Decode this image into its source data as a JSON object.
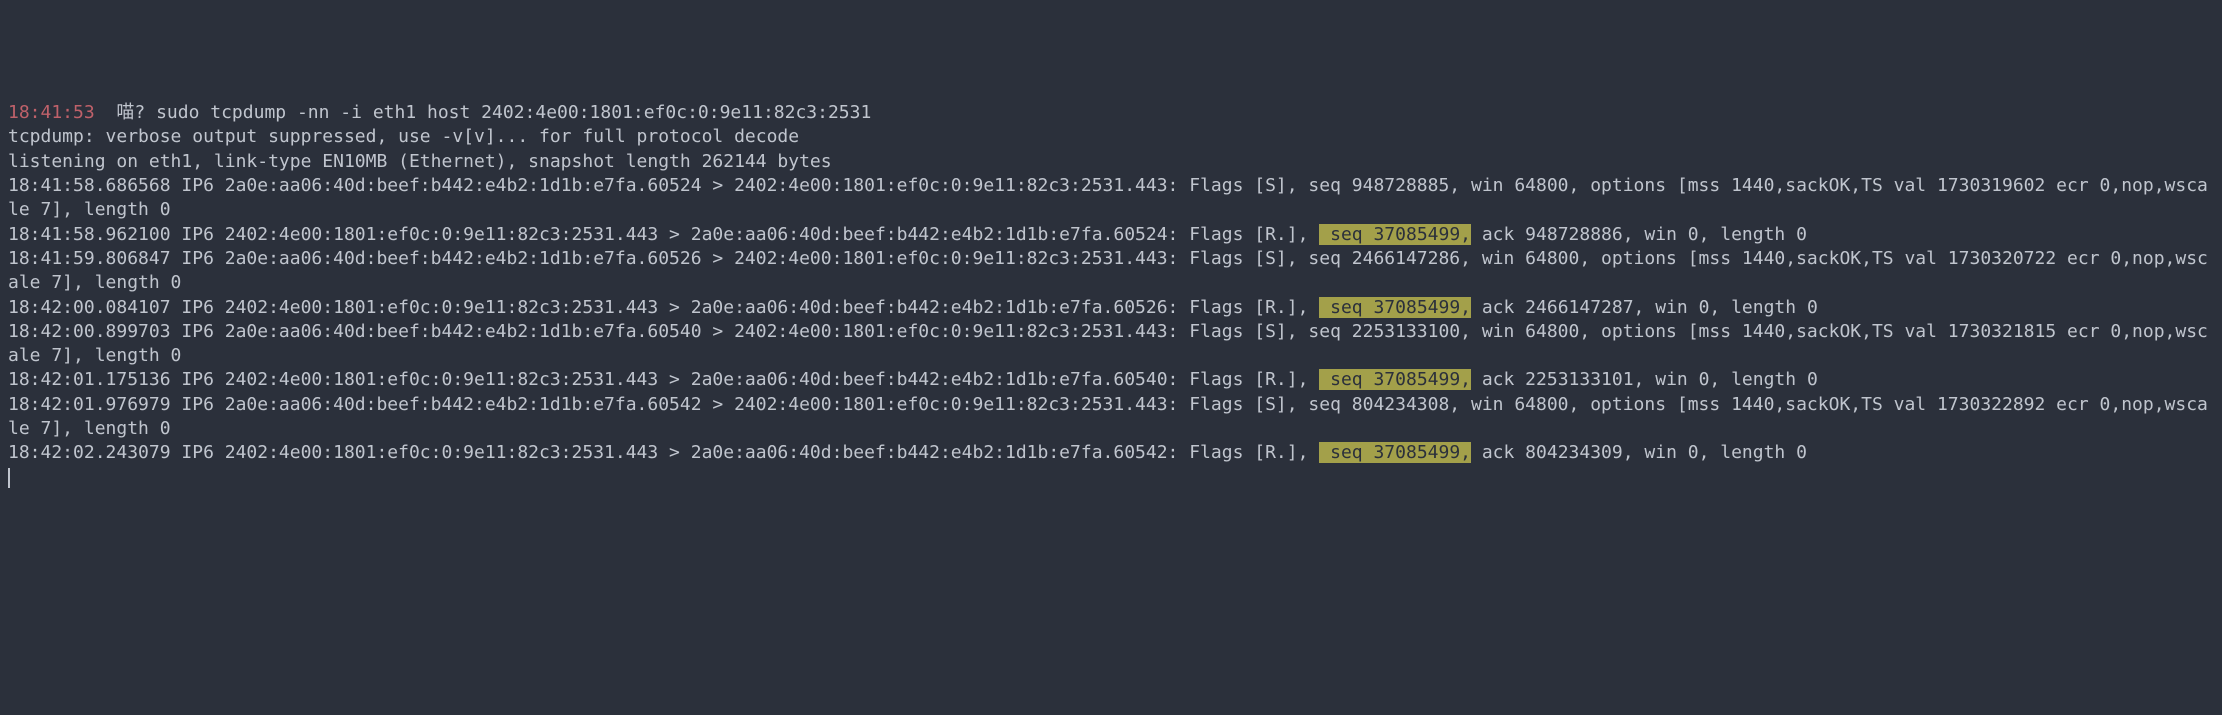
{
  "prompt": {
    "timestamp": "18:41:53",
    "marker": "喵?",
    "command": "sudo tcpdump -nn -i eth1 host 2402:4e00:1801:ef0c:0:9e11:82c3:2531"
  },
  "lines": [
    {
      "text": "tcpdump: verbose output suppressed, use -v[v]... for full protocol decode",
      "highlight": null
    },
    {
      "text": "listening on eth1, link-type EN10MB (Ethernet), snapshot length 262144 bytes",
      "highlight": null
    },
    {
      "text": "18:41:58.686568 IP6 2a0e:aa06:40d:beef:b442:e4b2:1d1b:e7fa.60524 > 2402:4e00:1801:ef0c:0:9e11:82c3:2531.443: Flags [S], seq 948728885, win 64800, options [mss 1440,sackOK,TS val 1730319602 ecr 0,nop,wscale 7], length 0",
      "highlight": null
    },
    {
      "text": "18:41:58.962100 IP6 2402:4e00:1801:ef0c:0:9e11:82c3:2531.443 > 2a0e:aa06:40d:beef:b442:e4b2:1d1b:e7fa.60524: Flags [R.], ",
      "highlight": "seq 37085499,",
      "after": " ack 948728886, win 0, length 0"
    },
    {
      "text": "18:41:59.806847 IP6 2a0e:aa06:40d:beef:b442:e4b2:1d1b:e7fa.60526 > 2402:4e00:1801:ef0c:0:9e11:82c3:2531.443: Flags [S], seq 2466147286, win 64800, options [mss 1440,sackOK,TS val 1730320722 ecr 0,nop,wscale 7], length 0",
      "highlight": null
    },
    {
      "text": "18:42:00.084107 IP6 2402:4e00:1801:ef0c:0:9e11:82c3:2531.443 > 2a0e:aa06:40d:beef:b442:e4b2:1d1b:e7fa.60526: Flags [R.], ",
      "highlight": "seq 37085499,",
      "after": " ack 2466147287, win 0, length 0"
    },
    {
      "text": "18:42:00.899703 IP6 2a0e:aa06:40d:beef:b442:e4b2:1d1b:e7fa.60540 > 2402:4e00:1801:ef0c:0:9e11:82c3:2531.443: Flags [S], seq 2253133100, win 64800, options [mss 1440,sackOK,TS val 1730321815 ecr 0,nop,wscale 7], length 0",
      "highlight": null
    },
    {
      "text": "18:42:01.175136 IP6 2402:4e00:1801:ef0c:0:9e11:82c3:2531.443 > 2a0e:aa06:40d:beef:b442:e4b2:1d1b:e7fa.60540: Flags [R.], ",
      "highlight": "seq 37085499,",
      "after": " ack 2253133101, win 0, length 0"
    },
    {
      "text": "18:42:01.976979 IP6 2a0e:aa06:40d:beef:b442:e4b2:1d1b:e7fa.60542 > 2402:4e00:1801:ef0c:0:9e11:82c3:2531.443: Flags [S], seq 804234308, win 64800, options [mss 1440,sackOK,TS val 1730322892 ecr 0,nop,wscale 7], length 0",
      "highlight": null
    },
    {
      "text": "18:42:02.243079 IP6 2402:4e00:1801:ef0c:0:9e11:82c3:2531.443 > 2a0e:aa06:40d:beef:b442:e4b2:1d1b:e7fa.60542: Flags [R.], ",
      "highlight": "seq 37085499,",
      "after": " ack 804234309, win 0, length 0"
    }
  ]
}
